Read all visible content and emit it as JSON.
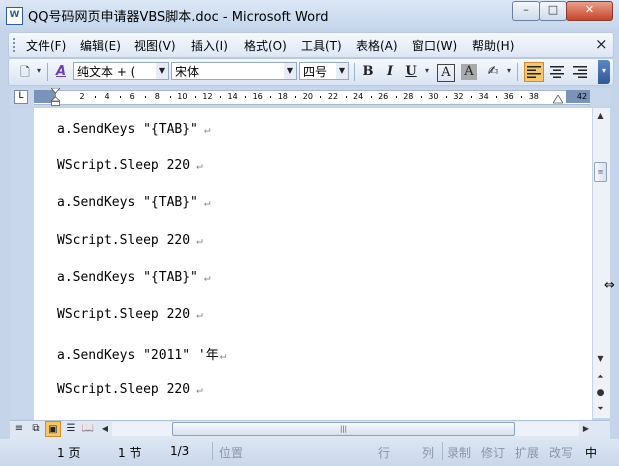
{
  "window": {
    "title": "QQ号码网页申请器VBS脚本.doc - Microsoft Word",
    "icon": "W",
    "minimize_label": "–",
    "maximize_label": "□",
    "close_label": "✕"
  },
  "menu": {
    "items": [
      "文件(F)",
      "编辑(E)",
      "视图(V)",
      "插入(I)",
      "格式(O)",
      "工具(T)",
      "表格(A)",
      "窗口(W)",
      "帮助(H)"
    ],
    "close_label": "×"
  },
  "toolbar": {
    "style_value": "纯文本 + (",
    "font_value": "宋体",
    "size_value": "四号",
    "bold": "B",
    "italic": "I",
    "underline": "U",
    "char_border": "A",
    "char_shading": "A",
    "highlight": "✍",
    "styles_icon": "A"
  },
  "ruler": {
    "tab_selector": "L",
    "ticks": [
      "2",
      "4",
      "6",
      "8",
      "10",
      "12",
      "14",
      "16",
      "18",
      "20",
      "22",
      "24",
      "26",
      "28",
      "30",
      "32",
      "34",
      "36",
      "38",
      "42"
    ]
  },
  "document": {
    "lines": [
      "a.SendKeys \"{TAB}\"",
      "WScript.Sleep 220",
      "a.SendKeys \"{TAB}\"",
      "WScript.Sleep 220",
      "a.SendKeys \"{TAB}\"",
      "WScript.Sleep 220",
      "a.SendKeys \"2011\" '年",
      "WScript.Sleep 220"
    ],
    "paragraph_mark": "↵"
  },
  "statusbar": {
    "page": "1 页",
    "section": "1 节",
    "page_count": "1/3",
    "position": "位置",
    "line": "行",
    "column": "列",
    "record": "录制",
    "revision": "修订",
    "extend": "扩展",
    "overtype": "改写",
    "language": "中"
  }
}
